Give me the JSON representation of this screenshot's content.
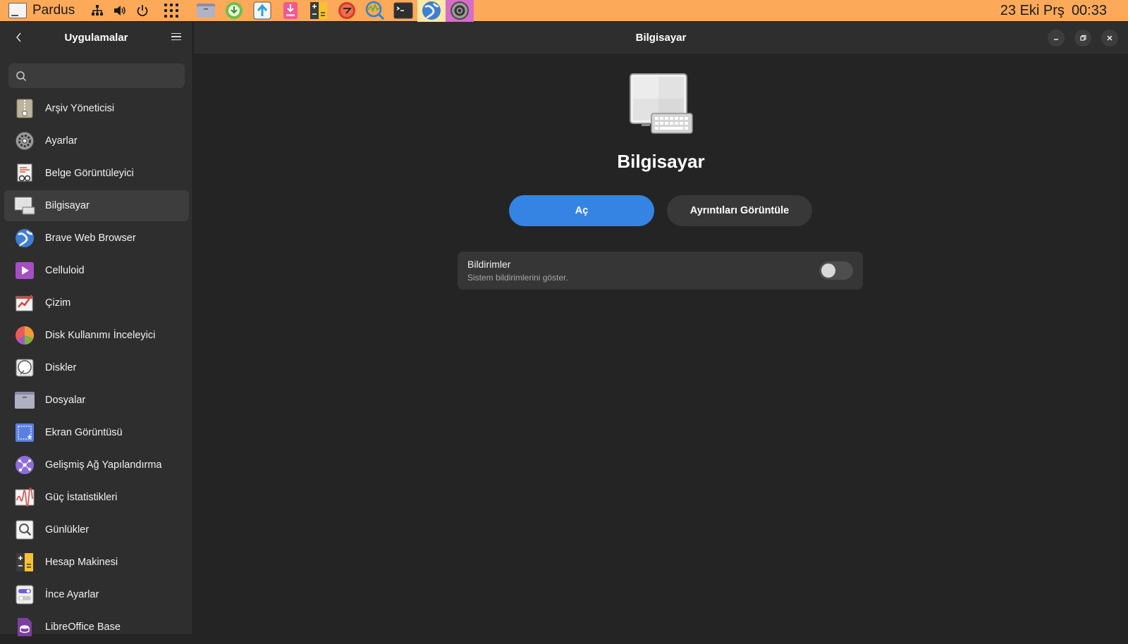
{
  "top_panel": {
    "brand": "Pardus",
    "date": "23 Eki Prş",
    "time": "00:33",
    "system_icons": [
      "network-icon",
      "volume-icon",
      "power-icon"
    ],
    "pinned_apps": [
      {
        "name": "files",
        "icon": "folder-icon"
      },
      {
        "name": "downloader",
        "icon": "download-icon"
      },
      {
        "name": "updater",
        "icon": "upload-arrow-icon"
      },
      {
        "name": "package-installer",
        "icon": "package-icon"
      },
      {
        "name": "calculator",
        "icon": "calculator-icon"
      },
      {
        "name": "system-monitor",
        "icon": "monitor-icon"
      },
      {
        "name": "system-scan",
        "icon": "chart-search-icon"
      },
      {
        "name": "terminal",
        "icon": "terminal-icon"
      },
      {
        "name": "browser",
        "icon": "globe-icon"
      },
      {
        "name": "settings",
        "icon": "gear-icon"
      }
    ]
  },
  "sidebar": {
    "title": "Uygulamalar",
    "search": {
      "value": "",
      "placeholder": ""
    },
    "items": [
      {
        "label": "Arşiv Yöneticisi",
        "icon": "archive-icon"
      },
      {
        "label": "Ayarlar",
        "icon": "gear-icon"
      },
      {
        "label": "Belge Görüntüleyici",
        "icon": "document-viewer-icon"
      },
      {
        "label": "Bilgisayar",
        "icon": "computer-icon"
      },
      {
        "label": "Brave Web Browser",
        "icon": "globe-icon"
      },
      {
        "label": "Celluloid",
        "icon": "play-icon"
      },
      {
        "label": "Çizim",
        "icon": "drawing-icon"
      },
      {
        "label": "Disk Kullanımı İnceleyici",
        "icon": "pie-chart-icon"
      },
      {
        "label": "Diskler",
        "icon": "disk-icon"
      },
      {
        "label": "Dosyalar",
        "icon": "folder-icon"
      },
      {
        "label": "Ekran Görüntüsü",
        "icon": "screenshot-icon"
      },
      {
        "label": "Gelişmiş Ağ Yapılandırma",
        "icon": "network-config-icon"
      },
      {
        "label": "Güç İstatistikleri",
        "icon": "power-stats-icon"
      },
      {
        "label": "Günlükler",
        "icon": "logs-icon"
      },
      {
        "label": "Hesap Makinesi",
        "icon": "calculator-icon"
      },
      {
        "label": "İnce Ayarlar",
        "icon": "tweaks-icon"
      },
      {
        "label": "LibreOffice Base",
        "icon": "libreoffice-base-icon"
      }
    ],
    "selected_index": 3
  },
  "main": {
    "header_title": "Bilgisayar",
    "app_name": "Bilgisayar",
    "open_label": "Aç",
    "details_label": "Ayrıntıları Görüntüle",
    "notifications": {
      "title": "Bildirimler",
      "subtitle": "Sistem bildirimlerini göster.",
      "enabled": false
    }
  },
  "colors": {
    "panel": "#fca95a",
    "accent": "#3584e4",
    "sidebar_bg": "#2e2e2e",
    "content_bg": "#242424"
  }
}
